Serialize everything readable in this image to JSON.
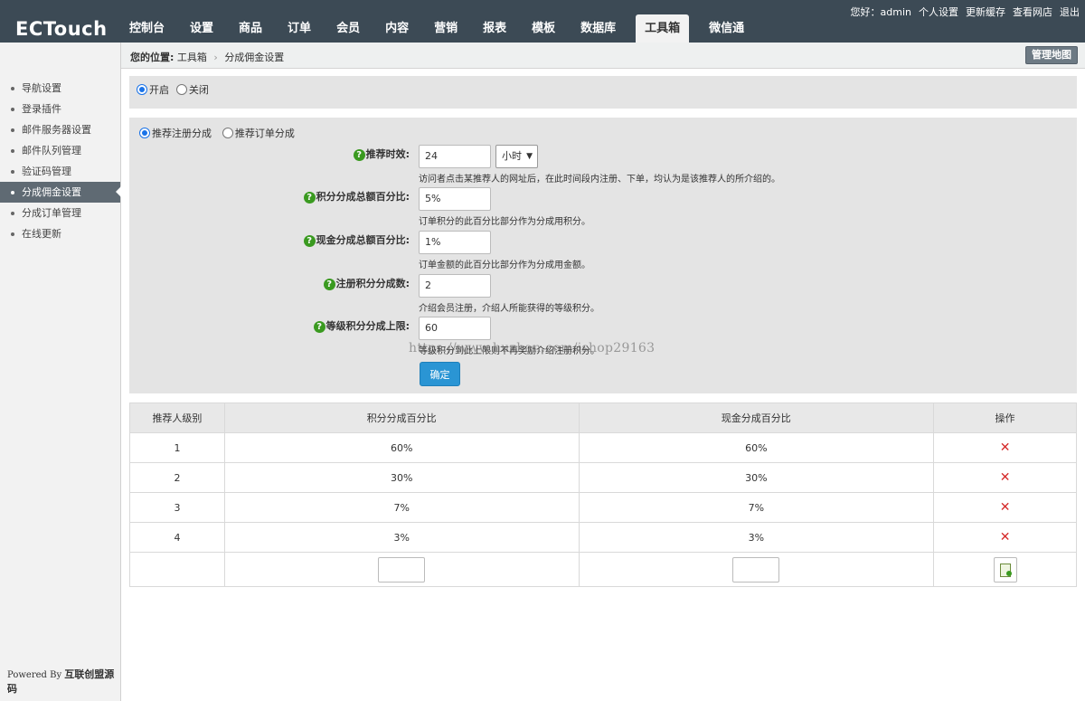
{
  "header": {
    "logo": "ECTouch",
    "nav": [
      "控制台",
      "设置",
      "商品",
      "订单",
      "会员",
      "内容",
      "营销",
      "报表",
      "模板",
      "数据库",
      "工具箱",
      "微信通"
    ],
    "active_nav": "工具箱",
    "greeting": "您好：admin",
    "links": [
      "个人设置",
      "更新缓存",
      "查看网店",
      "退出"
    ]
  },
  "sidebar": {
    "items": [
      "导航设置",
      "登录插件",
      "邮件服务器设置",
      "邮件队列管理",
      "验证码管理",
      "分成佣金设置",
      "分成订单管理",
      "在线更新"
    ],
    "active": "分成佣金设置",
    "powered_prefix": "Powered By",
    "powered_brand": "互联创盟源码"
  },
  "breadcrumb": {
    "label": "您的位置:",
    "path": [
      "工具箱",
      "分成佣金设置"
    ],
    "sitemap_button": "管理地图"
  },
  "toggle": {
    "on_label": "开启",
    "off_label": "关闭",
    "selected": "开启"
  },
  "mode": {
    "option1": "推荐注册分成",
    "option2": "推荐订单分成",
    "selected": "推荐注册分成"
  },
  "form": {
    "expire": {
      "label": "推荐时效:",
      "value": "24",
      "unit": "小时",
      "hint": "访问者点击某推荐人的网址后，在此时间段内注册、下单，均认为是该推荐人的所介绍的。"
    },
    "point_percent": {
      "label": "积分分成总额百分比:",
      "value": "5%",
      "hint": "订单积分的此百分比部分作为分成用积分。"
    },
    "money_percent": {
      "label": "现金分成总额百分比:",
      "value": "1%",
      "hint": "订单金额的此百分比部分作为分成用金额。"
    },
    "reg_points": {
      "label": "注册积分分成数:",
      "value": "2",
      "hint": "介绍会员注册，介绍人所能获得的等级积分。"
    },
    "level_limit": {
      "label": "等级积分分成上限:",
      "value": "60",
      "hint": "等级积分到此上限则不再奖励介绍注册积分。"
    },
    "submit": "确定"
  },
  "watermark": "https://www.huzhan.com/ishop29163",
  "table": {
    "headers": [
      "推荐人级别",
      "积分分成百分比",
      "现金分成百分比",
      "操作"
    ],
    "rows": [
      [
        "1",
        "60%",
        "60%"
      ],
      [
        "2",
        "30%",
        "30%"
      ],
      [
        "3",
        "7%",
        "7%"
      ],
      [
        "4",
        "3%",
        "3%"
      ]
    ],
    "delete_symbol": "✕"
  },
  "colors": {
    "header_bg": "#3c4a55",
    "sidebar_active": "#5f6a73",
    "button_blue": "#2a95d4",
    "delete_red": "#d52a2a",
    "help_green": "#3a9a20"
  }
}
